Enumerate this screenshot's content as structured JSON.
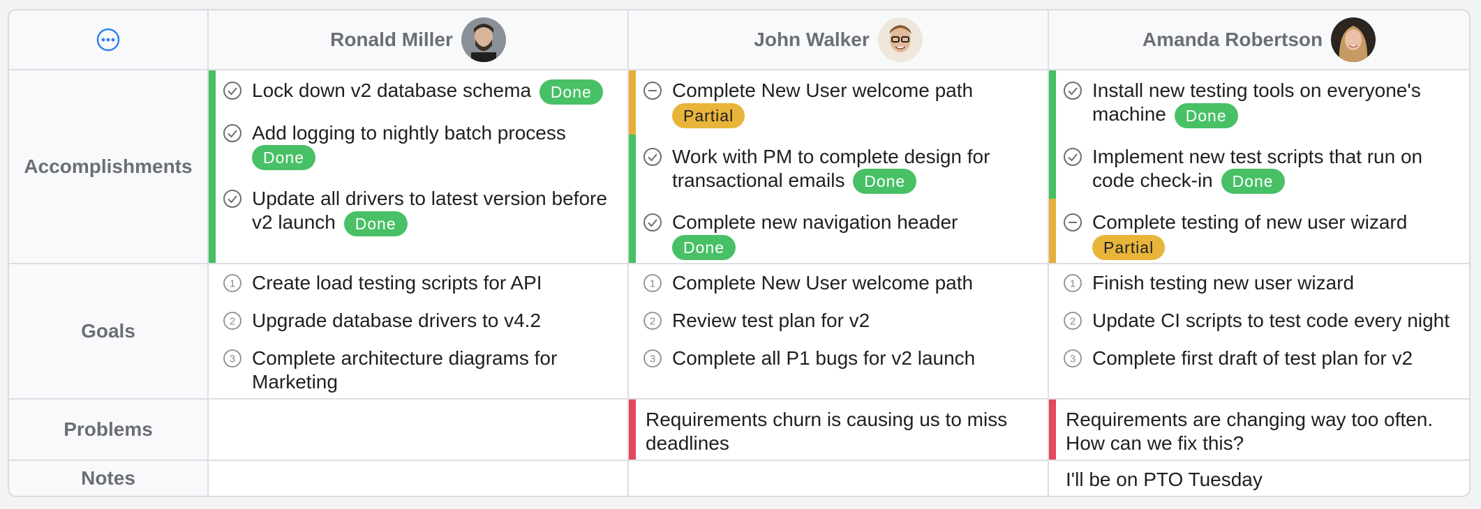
{
  "columns": [
    {
      "name": "Ronald Miller"
    },
    {
      "name": "John Walker"
    },
    {
      "name": "Amanda Robertson"
    }
  ],
  "rows": {
    "accomplishments": "Accomplishments",
    "goals": "Goals",
    "problems": "Problems",
    "notes": "Notes"
  },
  "badges": {
    "done": "Done",
    "partial": "Partial"
  },
  "accomplishments": {
    "ronald": [
      {
        "text": "Lock down v2 database schema",
        "status": "Done"
      },
      {
        "text": "Add logging to nightly batch process",
        "status": "Done"
      },
      {
        "text": "Update all drivers to latest version before v2 launch",
        "status": "Done"
      }
    ],
    "john": [
      {
        "text": "Complete New User welcome path",
        "status": "Partial"
      },
      {
        "text": "Work with PM to complete design for transactional emails",
        "status": "Done"
      },
      {
        "text": "Complete new navigation header",
        "status": "Done"
      }
    ],
    "amanda": [
      {
        "text": "Install new testing tools on everyone's machine",
        "status": "Done"
      },
      {
        "text": "Implement new test scripts that run on code check-in",
        "status": "Done"
      },
      {
        "text": "Complete testing of new user wizard",
        "status": "Partial"
      }
    ]
  },
  "goals": {
    "ronald": [
      "Create load testing scripts for API",
      "Upgrade database drivers to v4.2",
      "Complete architecture diagrams for Marketing"
    ],
    "john": [
      "Complete New User welcome path",
      "Review test plan for v2",
      "Complete all P1 bugs for v2 launch"
    ],
    "amanda": [
      "Finish testing new user wizard",
      "Update CI scripts to test code every night",
      "Complete first draft of test plan for v2"
    ]
  },
  "problems": {
    "ronald": "",
    "john": "Requirements churn is causing us to miss deadlines",
    "amanda": "Requirements are changing way too often. How can we fix this?"
  },
  "notes": {
    "ronald": "",
    "john": "",
    "amanda": "I'll be on PTO Tuesday"
  },
  "colors": {
    "done": "#48c065",
    "partial": "#e8b53a",
    "problem": "#e2495a",
    "accent": "#2f80ed"
  }
}
